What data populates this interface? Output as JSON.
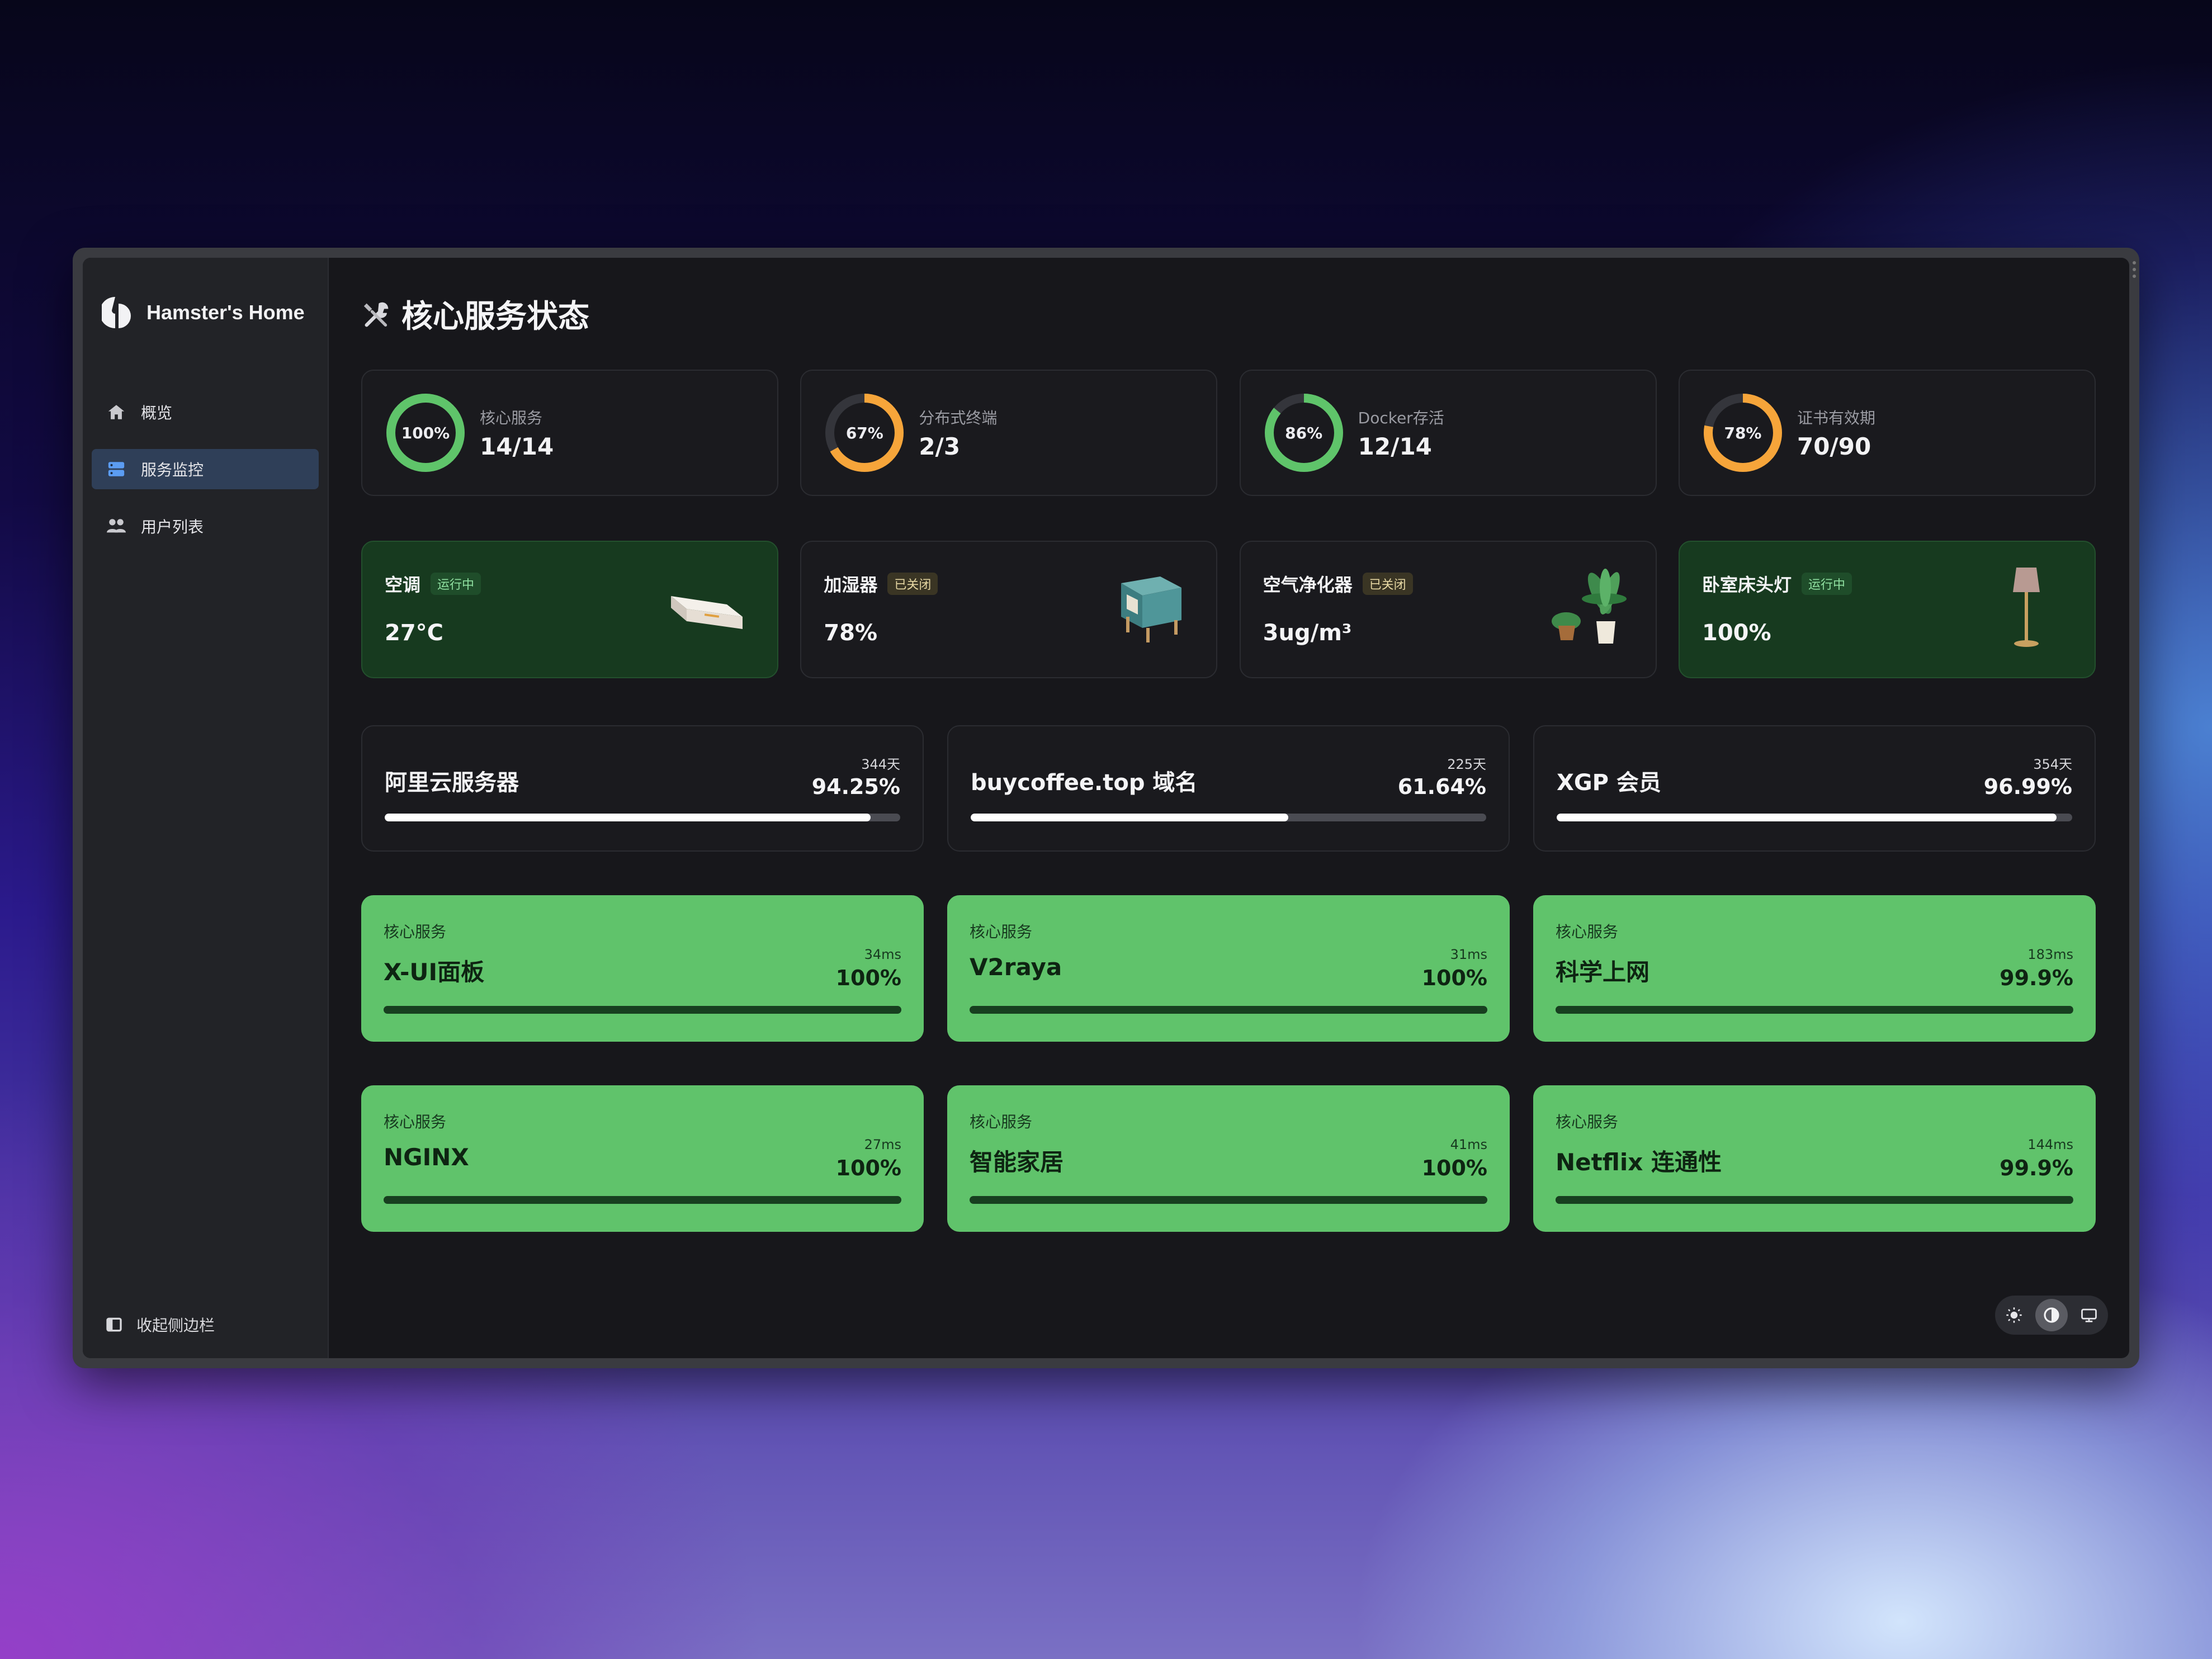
{
  "app": {
    "brand": "Hamster's Home"
  },
  "sidebar": {
    "items": [
      {
        "label": "概览",
        "icon": "home-icon"
      },
      {
        "label": "服务监控",
        "icon": "server-icon",
        "active": true
      },
      {
        "label": "用户列表",
        "icon": "users-icon"
      }
    ],
    "collapse_label": "收起侧边栏"
  },
  "page": {
    "title": "核心服务状态",
    "title_icon": "tools-icon"
  },
  "stats": [
    {
      "ring": "100%",
      "label": "核心服务",
      "value": "14/14",
      "percent": 100,
      "color": "#5fc46a"
    },
    {
      "ring": "67%",
      "label": "分布式终端",
      "value": "2/3",
      "percent": 67,
      "color": "#f6a53a"
    },
    {
      "ring": "86%",
      "label": "Docker存活",
      "value": "12/14",
      "percent": 86,
      "color": "#5fc46a"
    },
    {
      "ring": "78%",
      "label": "证书有效期",
      "value": "70/90",
      "percent": 78,
      "color": "#f6a53a"
    }
  ],
  "devices": [
    {
      "name": "空调",
      "status": "运行中",
      "on": true,
      "value": "27°C",
      "image": "air-conditioner"
    },
    {
      "name": "加湿器",
      "status": "已关闭",
      "on": false,
      "value": "78%",
      "image": "humidifier"
    },
    {
      "name": "空气净化器",
      "status": "已关闭",
      "on": false,
      "value": "3ug/m³",
      "image": "plants"
    },
    {
      "name": "卧室床头灯",
      "status": "运行中",
      "on": true,
      "value": "100%",
      "image": "floor-lamp"
    }
  ],
  "subscriptions": [
    {
      "name": "阿里云服务器",
      "days": "344天",
      "percent_label": "94.25%",
      "percent": 94.25
    },
    {
      "name": "buycoffee.top 域名",
      "days": "225天",
      "percent_label": "61.64%",
      "percent": 61.64
    },
    {
      "name": "XGP 会员",
      "days": "354天",
      "percent_label": "96.99%",
      "percent": 96.99
    }
  ],
  "services": [
    {
      "category": "核心服务",
      "name": "X-UI面板",
      "latency": "34ms",
      "uptime": "100%",
      "percent": 100
    },
    {
      "category": "核心服务",
      "name": "V2raya",
      "latency": "31ms",
      "uptime": "100%",
      "percent": 100
    },
    {
      "category": "核心服务",
      "name": "科学上网",
      "latency": "183ms",
      "uptime": "99.9%",
      "percent": 99.9
    },
    {
      "category": "核心服务",
      "name": "NGINX",
      "latency": "27ms",
      "uptime": "100%",
      "percent": 100
    },
    {
      "category": "核心服务",
      "name": "智能家居",
      "latency": "41ms",
      "uptime": "100%",
      "percent": 100
    },
    {
      "category": "核心服务",
      "name": "Netflix 连通性",
      "latency": "144ms",
      "uptime": "99.9%",
      "percent": 99.9
    }
  ],
  "theme": {
    "options": [
      "light",
      "auto",
      "system"
    ],
    "active": "auto"
  }
}
